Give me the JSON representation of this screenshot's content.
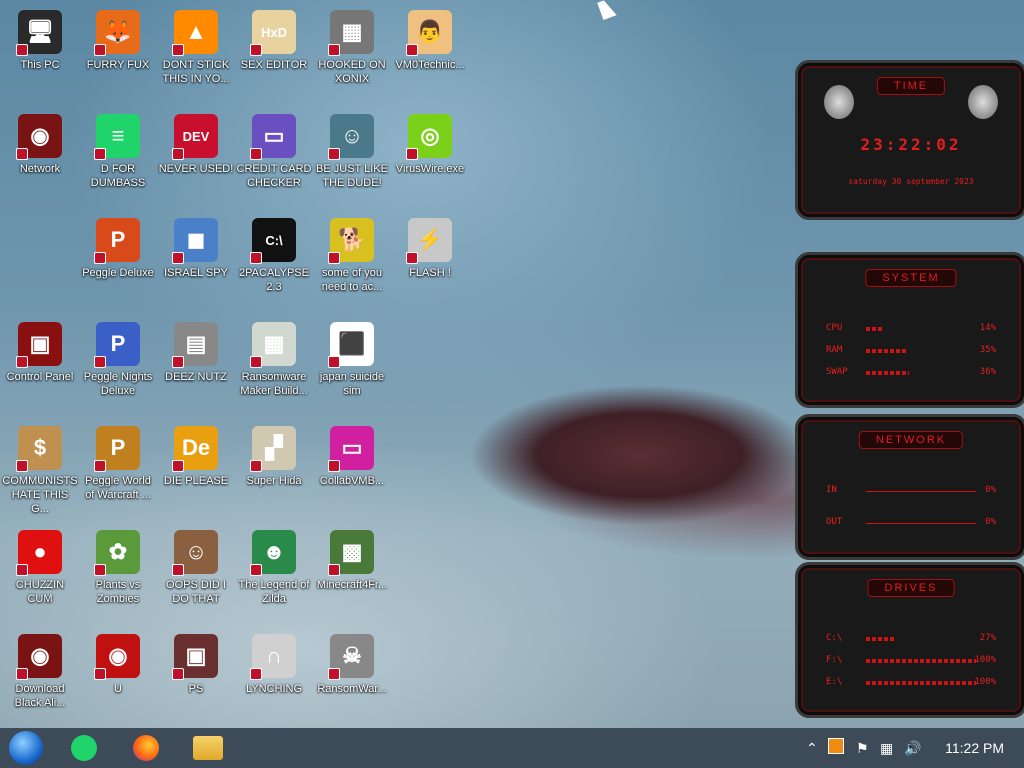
{
  "desktop": {
    "icons": [
      {
        "label": "This PC",
        "glyph": "🖥",
        "color": "#2a2a2a"
      },
      {
        "label": "FURRY FUX",
        "glyph": "🦊",
        "color": "#e86b1a"
      },
      {
        "label": "DONT STICK THIS IN YO...",
        "glyph": "▲",
        "color": "#ff8a00"
      },
      {
        "label": "SEX EDITOR",
        "glyph": "HxD",
        "color": "#e8d2a0"
      },
      {
        "label": "HOOKED ON XONIX",
        "glyph": "▦",
        "color": "#777777"
      },
      {
        "label": "VM0Technic...",
        "glyph": "👨",
        "color": "#f0c080"
      },
      {
        "label": "Network",
        "glyph": "◉",
        "color": "#7a1414"
      },
      {
        "label": "D FOR DUMBASS",
        "glyph": "≡",
        "color": "#1fd46a"
      },
      {
        "label": "NEVER USED!",
        "glyph": "DEV",
        "color": "#c8102e"
      },
      {
        "label": "CREDIT CARD CHECKER",
        "glyph": "▭",
        "color": "#6a4fc0"
      },
      {
        "label": "BE JUST LIKE THE DUDE!",
        "glyph": "☺",
        "color": "#4a7a8a"
      },
      {
        "label": "VirusWire.exe",
        "glyph": "◎",
        "color": "#7bd11a"
      },
      {
        "label": "Peggle Deluxe",
        "glyph": "P",
        "color": "#d84a1a"
      },
      {
        "label": "ISRAEL SPY",
        "glyph": "◼",
        "color": "#4a80c8"
      },
      {
        "label": "2PACALYPSE 2.3",
        "glyph": "C:\\",
        "color": "#111111"
      },
      {
        "label": "some of you need to ac...",
        "glyph": "🐕",
        "color": "#d8c020"
      },
      {
        "label": "FLASH !",
        "glyph": "⚡",
        "color": "#c8c8c8"
      },
      {
        "label": "Control Panel",
        "glyph": "▣",
        "color": "#8a1010"
      },
      {
        "label": "Peggle Nights Deluxe",
        "glyph": "P",
        "color": "#3a60c8"
      },
      {
        "label": "DEEZ NUTZ",
        "glyph": "▤",
        "color": "#888888"
      },
      {
        "label": "Ransomware Maker Build...",
        "glyph": "▦",
        "color": "#d0d8d0"
      },
      {
        "label": "japan suicide sim",
        "glyph": "⬛",
        "color": "#ffffff"
      },
      {
        "label": "COMMUNISTS HATE THIS G...",
        "glyph": "$",
        "color": "#c09050"
      },
      {
        "label": "Peggle World of Warcraft ...",
        "glyph": "P",
        "color": "#c08020"
      },
      {
        "label": "DIE PLEASE",
        "glyph": "De",
        "color": "#e8a010"
      },
      {
        "label": "Super Hida",
        "glyph": "▞",
        "color": "#d0c8b0"
      },
      {
        "label": "CollabVMB...",
        "glyph": "▭",
        "color": "#d020a0"
      },
      {
        "label": "CHUZZIN CUM",
        "glyph": "●",
        "color": "#e01010"
      },
      {
        "label": "Plants vs Zombies",
        "glyph": "✿",
        "color": "#5a9a3a"
      },
      {
        "label": "OOPS DID I DO THAT",
        "glyph": "☺",
        "color": "#8a6040"
      },
      {
        "label": "The Legend of Zilda",
        "glyph": "☻",
        "color": "#2a8a4a"
      },
      {
        "label": "Minecraft4Fr...",
        "glyph": "▩",
        "color": "#4a7a3a"
      },
      {
        "label": "Download Black Ali...",
        "glyph": "◉",
        "color": "#7a1414"
      },
      {
        "label": "U",
        "glyph": "◉",
        "color": "#c01010"
      },
      {
        "label": "PS",
        "glyph": "▣",
        "color": "#6a3030"
      },
      {
        "label": "LYNCHING",
        "glyph": "∩",
        "color": "#d0d0d0"
      },
      {
        "label": "RansomWar...",
        "glyph": "☠",
        "color": "#888888"
      }
    ]
  },
  "widgets": {
    "time": {
      "title": "TIME",
      "clock": "23:22:02",
      "date": "saturday 30 september 2023"
    },
    "system": {
      "title": "SYSTEM",
      "rows": [
        {
          "label": "CPU",
          "value": "14%",
          "pct": 14
        },
        {
          "label": "RAM",
          "value": "35%",
          "pct": 35
        },
        {
          "label": "SWAP",
          "value": "36%",
          "pct": 36
        }
      ]
    },
    "network": {
      "title": "NETWORK",
      "rows": [
        {
          "label": "IN",
          "value": "0%"
        },
        {
          "label": "OUT",
          "value": "0%"
        }
      ]
    },
    "drives": {
      "title": "DRIVES",
      "rows": [
        {
          "label": "C:\\",
          "value": "27%",
          "pct": 27
        },
        {
          "label": "F:\\",
          "value": "100%",
          "pct": 100
        },
        {
          "label": "E:\\",
          "value": "100%",
          "pct": 100
        }
      ]
    }
  },
  "taskbar": {
    "clock": "11:22 PM",
    "apps": [
      "start-orb",
      "spotify-style-app",
      "firefox",
      "file-explorer"
    ],
    "tray": [
      "chevron-up-icon",
      "flag-icon",
      "network-icon",
      "volume-icon"
    ]
  }
}
